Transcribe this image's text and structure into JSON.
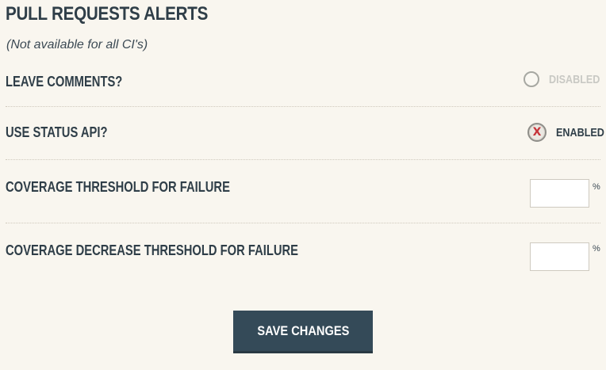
{
  "section": {
    "title": "PULL REQUESTS ALERTS",
    "subtitle": "(Not available for all CI's)"
  },
  "settings": {
    "leave_comments": {
      "label": "LEAVE COMMENTS?",
      "state": "disabled",
      "state_label": "DISABLED",
      "icon": "radio-empty-icon"
    },
    "use_status_api": {
      "label": "USE STATUS API?",
      "state": "enabled",
      "state_label": "ENABLED",
      "icon": "radio-x-icon",
      "mark": "X"
    },
    "coverage_threshold": {
      "label": "COVERAGE THRESHOLD FOR FAILURE",
      "value": "",
      "unit": "%"
    },
    "coverage_decrease_threshold": {
      "label": "COVERAGE DECREASE THRESHOLD FOR FAILURE",
      "value": "",
      "unit": "%"
    }
  },
  "actions": {
    "save_label": "SAVE CHANGES"
  },
  "colors": {
    "background": "#f9f6ef",
    "text": "#2f3e48",
    "disabled_text": "#c9c9c4",
    "enabled_mark": "#c6343a",
    "button_bg": "#344a58",
    "button_text": "#ffffff"
  }
}
